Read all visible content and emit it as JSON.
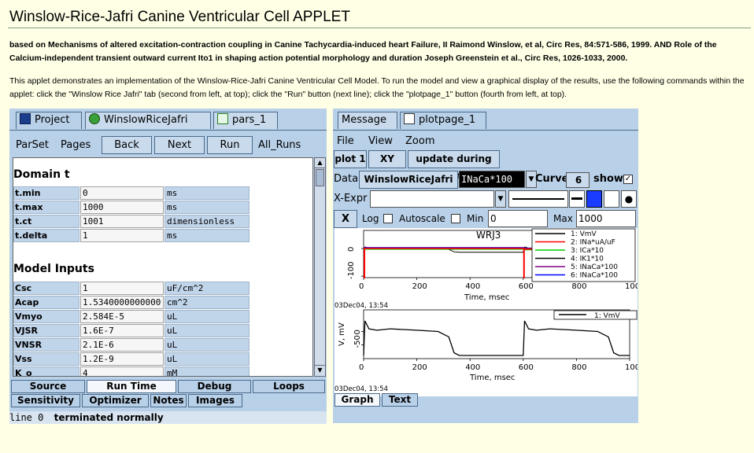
{
  "page": {
    "title": "Winslow-Rice-Jafri Canine Ventricular Cell APPLET",
    "citation": "based on Mechanisms of altered excitation-contraction coupling in Canine Tachycardia-induced heart Failure, II Raimond Winslow, et al, Circ Res, 84:571-586, 1999. AND Role of the Calcium-independent transient outward current Ito1 in shaping action potential morphology and duration Joseph Greenstein et al., Circ Res, 1026-1033, 2000.",
    "description": "This applet demonstrates an implementation of the Winslow-Rice-Jafri Canine Ventricular Cell Model. To run the model and view a graphical display of the results, use the following commands within the applet: click the \"Winslow Rice Jafri\" tab (second from left, at top); click the \"Run\" button (next line); click the \"plotpage_1\" button (fourth from left, at top)."
  },
  "left": {
    "tabs": [
      "Project",
      "WinslowRiceJafri",
      "pars_1"
    ],
    "toolbar": {
      "parset": "ParSet",
      "pages": "Pages",
      "back": "Back",
      "next": "Next",
      "run": "Run",
      "all_runs": "All_Runs"
    },
    "sections": {
      "domain": "Domain t",
      "inputs": "Model Inputs"
    },
    "domain_params": [
      {
        "name": "t.min",
        "value": "0",
        "unit": "ms"
      },
      {
        "name": "t.max",
        "value": "1000",
        "unit": "ms"
      },
      {
        "name": "t.ct",
        "value": "1001",
        "unit": "dimensionless"
      },
      {
        "name": "t.delta",
        "value": "1",
        "unit": "ms"
      }
    ],
    "input_params": [
      {
        "name": "Csc",
        "value": "1",
        "unit": "uF/cm^2"
      },
      {
        "name": "Acap",
        "value": "1.5340000000000",
        "unit": "cm^2"
      },
      {
        "name": "Vmyo",
        "value": "2.584E-5",
        "unit": "uL"
      },
      {
        "name": "VJSR",
        "value": "1.6E-7",
        "unit": "uL"
      },
      {
        "name": "VNSR",
        "value": "2.1E-6",
        "unit": "uL"
      },
      {
        "name": "Vss",
        "value": "1.2E-9",
        "unit": "uL"
      },
      {
        "name": "K_o",
        "value": "4",
        "unit": "mM"
      }
    ],
    "bottom_tabs_row1": [
      "Source",
      "Run Time",
      "Debug",
      "Loops"
    ],
    "bottom_tabs_row2": [
      "Sensitivity",
      "Optimizer",
      "Notes",
      "Images"
    ],
    "selected_bottom_tab": "Run Time"
  },
  "status": {
    "line": "line 0",
    "message": "terminated normally"
  },
  "right": {
    "tabs": [
      "Message",
      "plotpage_1"
    ],
    "menu": [
      "File",
      "View",
      "Zoom"
    ],
    "plot_buttons": {
      "plot1": "plot 1",
      "xyplot": "XY plot",
      "update": "update during run"
    },
    "data_row": {
      "data_label": "Data",
      "model": "WinslowRiceJafri",
      "variable": "INaCa*100",
      "curve_label": "Curve",
      "curve": "6",
      "show_label": "show",
      "show_checked": true
    },
    "xexpr_label": "X-Expr",
    "axis_row": {
      "x_btn": "X",
      "log": "Log",
      "autoscale": "Autoscale",
      "min_label": "Min",
      "min": "0",
      "max_label": "Max",
      "max": "1000"
    },
    "bottom_tabs": [
      "Graph",
      "Text"
    ],
    "colors": {
      "swatch_selected": "#1a3cff"
    }
  },
  "chart_data": [
    {
      "type": "line",
      "title": "WRJ3",
      "xlabel": "Time, msec",
      "ylabel": "",
      "xlim": [
        0,
        1000
      ],
      "x_ticks": [
        0,
        200,
        400,
        600,
        800,
        1000
      ],
      "y_ticks": [
        0,
        -100
      ],
      "timestamp": "03Dec04, 13:54",
      "legend": [
        {
          "name": "1: VmV",
          "color": "#000000"
        },
        {
          "name": "2: INa*uA/uF",
          "color": "#ff0000"
        },
        {
          "name": "3: ICa*10",
          "color": "#00cc00"
        },
        {
          "name": "4: IK1*10",
          "color": "#000000"
        },
        {
          "name": "5: INaCa*100",
          "color": "#800080"
        },
        {
          "name": "6: INaCa*100",
          "color": "#0000ff"
        }
      ]
    },
    {
      "type": "line",
      "title": "",
      "xlabel": "Time, msec",
      "ylabel": "V, mV",
      "xlim": [
        0,
        1000
      ],
      "x_ticks": [
        0,
        200,
        400,
        600,
        800,
        1000
      ],
      "y_ticks": [
        0,
        -50
      ],
      "timestamp": "03Dec04, 13:54",
      "legend": [
        {
          "name": "1: VmV",
          "color": "#000000"
        }
      ],
      "series": [
        {
          "name": "1: VmV",
          "x": [
            0,
            5,
            10,
            20,
            50,
            100,
            200,
            280,
            320,
            340,
            360,
            600,
            605,
            610,
            620,
            650,
            700,
            800,
            880,
            920,
            940,
            960,
            1000
          ],
          "values": [
            -90,
            40,
            30,
            10,
            5,
            10,
            5,
            0,
            -20,
            -80,
            -90,
            -90,
            40,
            30,
            10,
            5,
            10,
            5,
            0,
            -20,
            -80,
            -90,
            -90
          ]
        }
      ]
    }
  ]
}
